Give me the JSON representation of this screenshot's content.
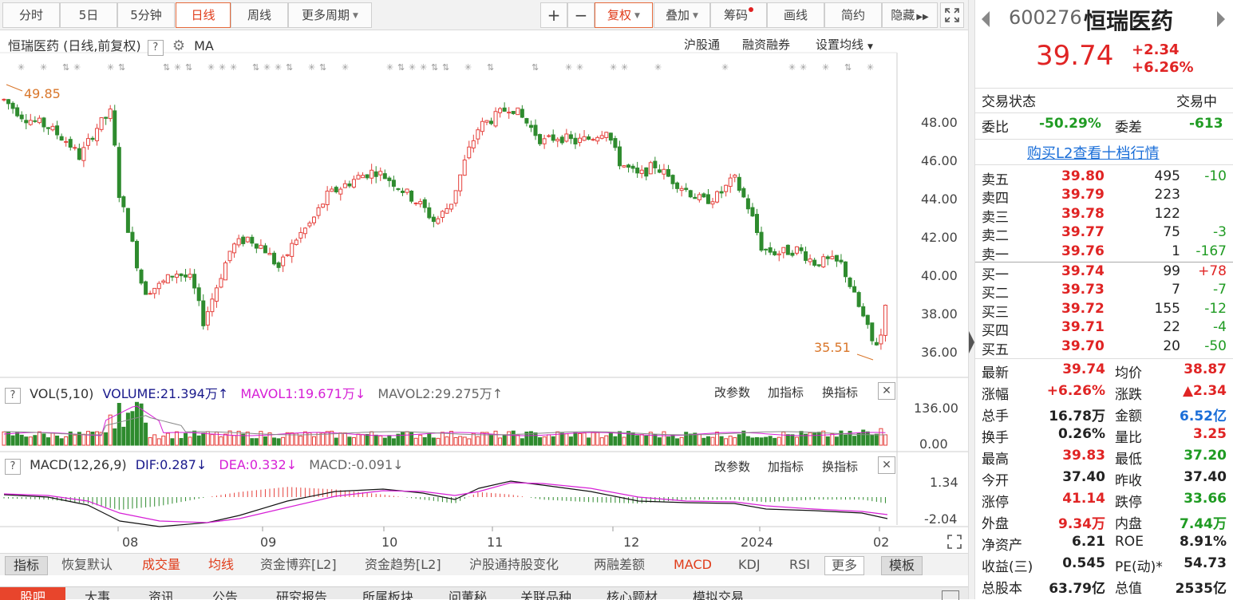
{
  "toolbar": {
    "periods": [
      "分时",
      "5日",
      "5分钟",
      "日线",
      "周线",
      "更多周期"
    ],
    "tools": [
      "+",
      "−",
      "复权",
      "叠加",
      "筹码",
      "画线",
      "简约",
      "隐藏"
    ],
    "expand_icon": "expand-icon"
  },
  "chart": {
    "title": "恒瑞医药 (日线,前复权)",
    "help": "?",
    "ma_label": "MA",
    "links": [
      "沪股通",
      "融资融券",
      "设置均线"
    ],
    "high_label": "49.85",
    "low_label": "35.51",
    "yticks": [
      "48.00",
      "46.00",
      "44.00",
      "42.00",
      "40.00",
      "38.00",
      "36.00"
    ]
  },
  "vol": {
    "name": "VOL(5,10)",
    "volume": "VOLUME:21.394万",
    "mavol1": "MAVOL1:19.671万",
    "mavol2": "MAVOL2:29.275万",
    "yticks": [
      "136.00",
      "0.00"
    ],
    "links": [
      "改参数",
      "加指标",
      "换指标"
    ]
  },
  "macd": {
    "name": "MACD(12,26,9)",
    "dif": "DIF:0.287",
    "dea": "DEA:0.332",
    "macd": "MACD:-0.091",
    "yticks": [
      "1.34",
      "-2.04"
    ],
    "links": [
      "改参数",
      "加指标",
      "换指标"
    ]
  },
  "xaxis": [
    "08",
    "09",
    "10",
    "11",
    "12",
    "2024",
    "02"
  ],
  "bottom_tabs": [
    "指标",
    "恢复默认",
    "成交量",
    "均线",
    "资金博弈[L2]",
    "资金趋势[L2]",
    "沪股通持股变化",
    "两融差额",
    "MACD",
    "KDJ",
    "RSI",
    "更多",
    "模板"
  ],
  "news_tabs": [
    "股吧",
    "大事",
    "资讯",
    "公告",
    "研究报告",
    "所属板块",
    "问董秘",
    "关联品种",
    "核心题材",
    "模拟交易"
  ],
  "quote": {
    "code": "600276",
    "name": "恒瑞医药",
    "price": "39.74",
    "change": "+2.34",
    "pct": "+6.26%",
    "status_label": "交易状态",
    "status": "交易中",
    "wb_label": "委比",
    "wb": "-50.29%",
    "wc_label": "委差",
    "wc": "-613",
    "l2_link": "购买L2查看十档行情",
    "asks": [
      {
        "label": "卖五",
        "price": "39.80",
        "vol": "495",
        "chg": "-10"
      },
      {
        "label": "卖四",
        "price": "39.79",
        "vol": "223",
        "chg": ""
      },
      {
        "label": "卖三",
        "price": "39.78",
        "vol": "122",
        "chg": ""
      },
      {
        "label": "卖二",
        "price": "39.77",
        "vol": "75",
        "chg": "-3"
      },
      {
        "label": "卖一",
        "price": "39.76",
        "vol": "1",
        "chg": "-167"
      }
    ],
    "bids": [
      {
        "label": "买一",
        "price": "39.74",
        "vol": "99",
        "chg": "+78"
      },
      {
        "label": "买二",
        "price": "39.73",
        "vol": "7",
        "chg": "-7"
      },
      {
        "label": "买三",
        "price": "39.72",
        "vol": "155",
        "chg": "-12"
      },
      {
        "label": "买四",
        "price": "39.71",
        "vol": "22",
        "chg": "-4"
      },
      {
        "label": "买五",
        "price": "39.70",
        "vol": "20",
        "chg": "-50"
      }
    ],
    "stats": [
      [
        "最新",
        "39.74",
        "red",
        "均价",
        "38.87",
        "red"
      ],
      [
        "涨幅",
        "+6.26%",
        "red",
        "涨跌",
        "▲2.34",
        "red"
      ],
      [
        "总手",
        "16.78万",
        "blk",
        "金额",
        "6.52亿",
        "blu"
      ],
      [
        "换手",
        "0.26%",
        "blk",
        "量比",
        "3.25",
        "red"
      ],
      [
        "最高",
        "39.83",
        "red",
        "最低",
        "37.20",
        "grn"
      ],
      [
        "今开",
        "37.40",
        "blk",
        "昨收",
        "37.40",
        "blk"
      ],
      [
        "涨停",
        "41.14",
        "red",
        "跌停",
        "33.66",
        "grn"
      ],
      [
        "外盘",
        "9.34万",
        "red",
        "内盘",
        "7.44万",
        "grn"
      ],
      [
        "净资产",
        "6.21",
        "blk",
        "ROE",
        "8.91%",
        "blk"
      ],
      [
        "收益(三)",
        "0.545",
        "blk",
        "PE(动)*",
        "54.73",
        "blk"
      ],
      [
        "总股本",
        "63.79亿",
        "blk",
        "总值",
        "2535亿",
        "blk"
      ]
    ]
  }
}
